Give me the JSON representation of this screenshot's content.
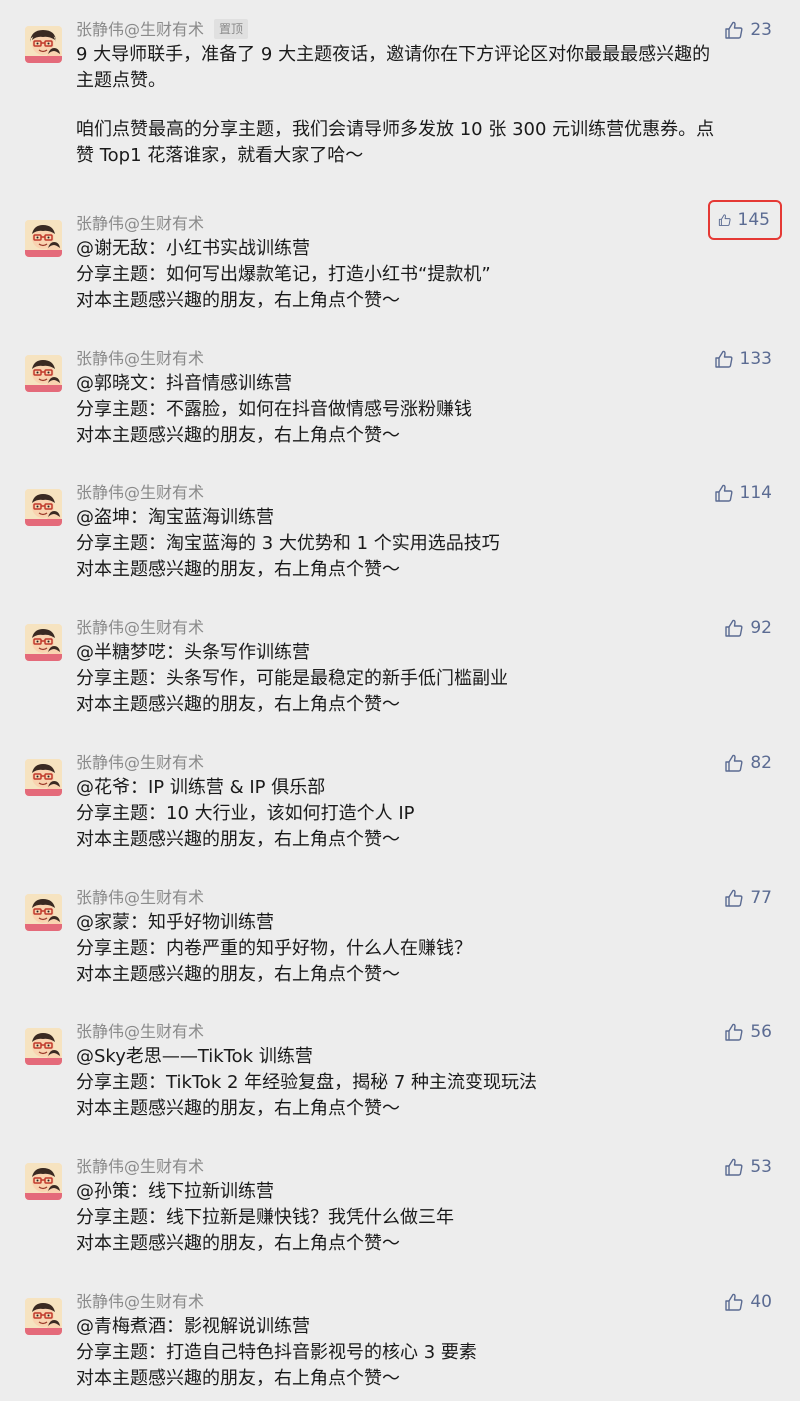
{
  "pinned_post": {
    "author": "张静伟@生财有术",
    "badge": "置顶",
    "likes": "23",
    "paragraph1": [
      "9 大导师联手，准备了 9 大主题夜话，邀请你在下方评论区对你最最最感兴趣的",
      "主题点赞。"
    ],
    "paragraph2": [
      "咱们点赞最高的分享主题，我们会请导师多发放 10 张 300 元训练营优惠券。点",
      "赞 Top1 花落谁家，就看大家了哈～"
    ]
  },
  "comments": [
    {
      "author": "张静伟@生财有术",
      "likes": "145",
      "line1": "@谢无敌：小红书实战训练营",
      "line2": "分享主题：如何写出爆款笔记，打造小红书“提款机”",
      "line3": "对本主题感兴趣的朋友，右上角点个赞～"
    },
    {
      "author": "张静伟@生财有术",
      "likes": "133",
      "line1": "@郭晓文：抖音情感训练营",
      "line2": "分享主题：不露脸，如何在抖音做情感号涨粉赚钱",
      "line3": "对本主题感兴趣的朋友，右上角点个赞～"
    },
    {
      "author": "张静伟@生财有术",
      "likes": "114",
      "line1": "@盗坤：淘宝蓝海训练营",
      "line2": "分享主题：淘宝蓝海的 3 大优势和 1 个实用选品技巧",
      "line3": "对本主题感兴趣的朋友，右上角点个赞～"
    },
    {
      "author": "张静伟@生财有术",
      "likes": "92",
      "line1": "@半糖梦呓：头条写作训练营",
      "line2": "分享主题：头条写作，可能是最稳定的新手低门槛副业",
      "line3": "对本主题感兴趣的朋友，右上角点个赞～"
    },
    {
      "author": "张静伟@生财有术",
      "likes": "82",
      "line1": "@花爷：IP 训练营 & IP 俱乐部",
      "line2": "分享主题：10 大行业，该如何打造个人 IP",
      "line3": "对本主题感兴趣的朋友，右上角点个赞～"
    },
    {
      "author": "张静伟@生财有术",
      "likes": "77",
      "line1": "@家蒙：知乎好物训练营",
      "line2": "分享主题：内卷严重的知乎好物，什么人在赚钱？",
      "line3": "对本主题感兴趣的朋友，右上角点个赞～"
    },
    {
      "author": "张静伟@生财有术",
      "likes": "56",
      "line1": "@Sky老思——TikTok 训练营",
      "line2": "分享主题：TikTok 2 年经验复盘，揭秘 7 种主流变现玩法",
      "line3": "对本主题感兴趣的朋友，右上角点个赞～"
    },
    {
      "author": "张静伟@生财有术",
      "likes": "53",
      "line1": "@孙策：线下拉新训练营",
      "line2": "分享主题：线下拉新是赚快钱？我凭什么做三年",
      "line3": "对本主题感兴趣的朋友，右上角点个赞～"
    },
    {
      "author": "张静伟@生财有术",
      "likes": "40",
      "line1": "@青梅煮酒：影视解说训练营",
      "line2": "分享主题：打造自己特色抖音影视号的核心 3 要素",
      "line3": "对本主题感兴趣的朋友，右上角点个赞～"
    }
  ],
  "colors": {
    "background": "#ededed",
    "like_blue": "#5b6b92",
    "author_gray": "#8a8a8a",
    "highlight_red": "#e53935"
  },
  "icons": {
    "like": "thumbs-up-icon",
    "avatar": "cartoon-avatar-icon"
  }
}
